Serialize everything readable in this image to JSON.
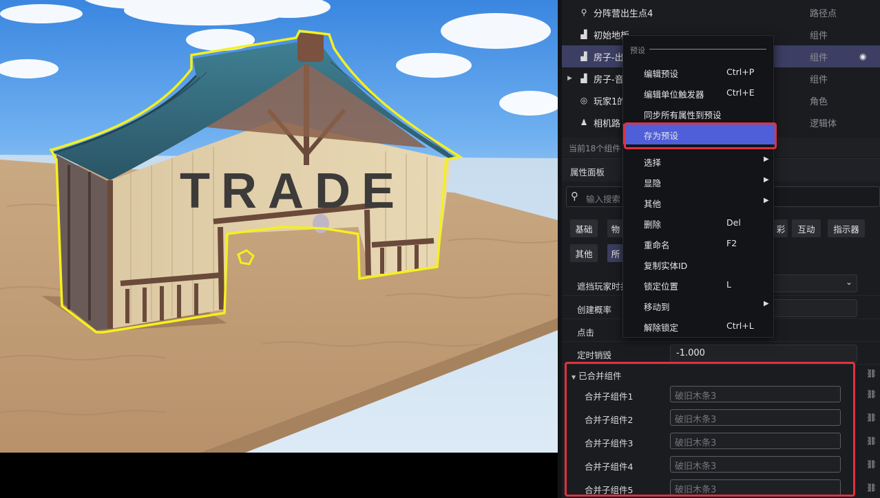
{
  "outliner": {
    "rows": [
      {
        "name": "分阵营出生点4",
        "type": "路径点",
        "icon": "waypoint-icon",
        "arrow": ""
      },
      {
        "name": "初始地板",
        "type": "组件",
        "icon": "component-icon",
        "arrow": ""
      },
      {
        "name": "房子-出",
        "type": "组件",
        "icon": "component-icon",
        "arrow": "",
        "selected": true
      },
      {
        "name": "房子-音",
        "type": "组件",
        "icon": "component-icon",
        "arrow": "▶"
      },
      {
        "name": "玩家1的",
        "type": "角色",
        "icon": "player-icon",
        "arrow": ""
      },
      {
        "name": "相机路",
        "type": "逻辑体",
        "icon": "logic-icon",
        "arrow": ""
      }
    ],
    "count_text": "当前18个组件"
  },
  "properties": {
    "header": "属性面板",
    "search_placeholder": "输入搜索",
    "tabs": [
      "基础",
      "物",
      "彩",
      "互动",
      "指示器",
      "其他",
      "所"
    ],
    "rows": [
      {
        "label": "遮挡玩家时扌",
        "value": ""
      },
      {
        "label": "创建概率",
        "value": ""
      },
      {
        "label": "点击",
        "value": ""
      },
      {
        "label": "定时销毁",
        "value": "-1.000"
      }
    ],
    "merged": {
      "title": "已合并组件",
      "children": [
        {
          "label": "合并子组件1",
          "value": "破旧木条3"
        },
        {
          "label": "合并子组件2",
          "value": "破旧木条3"
        },
        {
          "label": "合并子组件3",
          "value": "破旧木条3"
        },
        {
          "label": "合并子组件4",
          "value": "破旧木条3"
        },
        {
          "label": "合并子组件5",
          "value": "破旧木条3"
        }
      ]
    }
  },
  "context_menu": {
    "group_label": "预设",
    "items": [
      {
        "label": "编辑预设",
        "shortcut": "Ctrl+P"
      },
      {
        "label": "编辑单位触发器",
        "shortcut": "Ctrl+E"
      },
      {
        "label": "同步所有属性到预设",
        "shortcut": ""
      },
      {
        "label": "存为预设",
        "shortcut": "",
        "highlighted": true
      },
      {
        "label": "选择",
        "shortcut": "",
        "submenu": true
      },
      {
        "label": "显隐",
        "shortcut": "",
        "submenu": true
      },
      {
        "label": "其他",
        "shortcut": "",
        "submenu": true
      },
      {
        "label": "删除",
        "shortcut": "Del"
      },
      {
        "label": "重命名",
        "shortcut": "F2"
      },
      {
        "label": "复制实体ID",
        "shortcut": ""
      },
      {
        "label": "锁定位置",
        "shortcut": "L"
      },
      {
        "label": "移动到",
        "shortcut": "",
        "submenu": true
      },
      {
        "label": "解除锁定",
        "shortcut": "Ctrl+L"
      }
    ]
  },
  "viewport": {
    "sign_text": "TRADE"
  },
  "colors": {
    "accent": "#4f5ed9",
    "highlight_box": "#e0323e",
    "selection_outline": "#f5f01e"
  }
}
